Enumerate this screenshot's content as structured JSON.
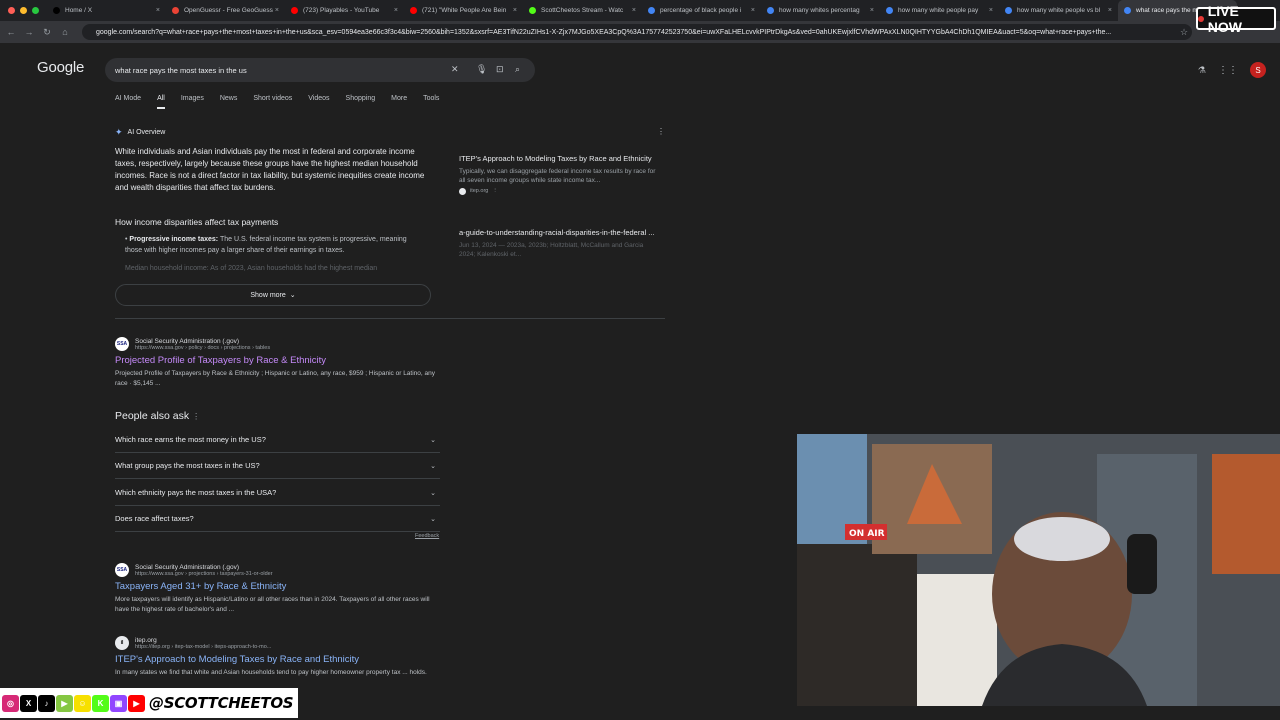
{
  "browser": {
    "tabs": [
      {
        "label": "Home / X",
        "color": "#000000"
      },
      {
        "label": "OpenGuessr - Free GeoGuess",
        "color": "#ea4335"
      },
      {
        "label": "(723) Playables - YouTube",
        "color": "#ff0000"
      },
      {
        "label": "(721) \"White People Are Bein",
        "color": "#ff0000"
      },
      {
        "label": "ScottCheetos Stream - Watc",
        "color": "#53fc18"
      },
      {
        "label": "percentage of black people i",
        "color": "#4285f4"
      },
      {
        "label": "how many whites percentag",
        "color": "#4285f4"
      },
      {
        "label": "how many white people pay",
        "color": "#4285f4"
      },
      {
        "label": "how many white people vs bl",
        "color": "#4285f4"
      },
      {
        "label": "what race pays the most",
        "color": "#4285f4"
      }
    ],
    "url": "google.com/search?q=what+race+pays+the+most+taxes+in+the+us&sca_esv=0594ea3e66c3f3c4&biw=2560&bih=1352&sxsrf=AE3TifN22uZIHs1-X-Zjx7MJGo5XEA3CpQ%3A1757742523750&ei=uwXFaLHELcvvkPIPtrDkgAs&ved=0ahUKEwjxlfCVhdWPAxXLN0QIHTYYGbA4ChDh1QMIEA&uact=5&oq=what+race+pays+the..."
  },
  "google": {
    "logo": "Google",
    "query": "what race pays the most taxes in the us",
    "nav_tabs": [
      "AI Mode",
      "All",
      "Images",
      "News",
      "Short videos",
      "Videos",
      "Shopping",
      "More",
      "Tools"
    ],
    "profile_initial": "S"
  },
  "ai_overview": {
    "label": "AI Overview",
    "text": "White individuals and Asian individuals pay the most in federal and corporate income taxes, respectively, largely because these groups have the highest median household incomes. Race is not a direct factor in tax liability, but systemic inequities create income and wealth disparities that affect tax burdens.",
    "subheading": "How income disparities affect tax payments",
    "bullet_bold": "Progressive income taxes:",
    "bullet_text": " The U.S. federal income tax system is progressive, meaning those with higher incomes pay a larger share of their earnings in taxes.",
    "faded_text": "Median household income: As of 2023, Asian households had the highest median",
    "show_more": "Show more",
    "sources": [
      {
        "title": "ITEP's Approach to Modeling Taxes by Race and Ethnicity",
        "desc": "Typically, we can disaggregate federal income tax results by race for all seven income groups while state income tax...",
        "site": "itep.org"
      },
      {
        "title": "a-guide-to-understanding-racial-disparities-in-the-federal ...",
        "desc": "Jun 13, 2024 — 2023a, 2023b; Holtzblatt, McCallum and Garcia 2024; Kalenkoski et...",
        "site": ""
      }
    ]
  },
  "results": [
    {
      "site": "Social Security Administration (.gov)",
      "url": "https://www.ssa.gov › policy › docs › projections › tables",
      "title": "Projected Profile of Taxpayers by Race & Ethnicity",
      "snippet": "Projected Profile of Taxpayers by Race & Ethnicity ; Hispanic or Latino, any race, $959 ; Hispanic or Latino, any race · $5,145 ...",
      "favicon": "SSA"
    },
    {
      "site": "Social Security Administration (.gov)",
      "url": "https://www.ssa.gov › projections › taxpayers-31-or-older",
      "title": "Taxpayers Aged 31+ by Race & Ethnicity",
      "snippet": "More taxpayers will identify as Hispanic/Latino or all other races than in 2024. Taxpayers of all other races will have the highest rate of bachelor's and ...",
      "favicon": "SSA"
    },
    {
      "site": "itep.org",
      "url": "https://itep.org › itep-tax-model › iteps-approach-to-mo...",
      "title": "ITEP's Approach to Modeling Taxes by Race and Ethnicity",
      "snippet": "In many states we find that white and Asian households tend to pay higher homeowner property tax ... holds.",
      "favicon": "il"
    }
  ],
  "people_also_ask": {
    "title": "People also ask",
    "questions": [
      "Which race earns the most money in the US?",
      "What group pays the most taxes in the US?",
      "Which ethnicity pays the most taxes in the USA?",
      "Does race affect taxes?"
    ],
    "feedback": "Feedback"
  },
  "overlay": {
    "live_label": "LIVE NOW",
    "handle": "@SCOTTCHEETOS",
    "social_icons": [
      {
        "name": "instagram-icon",
        "glyph": "◎",
        "color": "#d62976"
      },
      {
        "name": "x-icon",
        "glyph": "X",
        "color": "#000000"
      },
      {
        "name": "tiktok-icon",
        "glyph": "♪",
        "color": "#000000"
      },
      {
        "name": "rumble-icon",
        "glyph": "▶",
        "color": "#85c742"
      },
      {
        "name": "snapchat-icon",
        "glyph": "☺",
        "color": "#f7e000"
      },
      {
        "name": "kick-icon",
        "glyph": "K",
        "color": "#53fc18"
      },
      {
        "name": "twitch-icon",
        "glyph": "▣",
        "color": "#9146ff"
      },
      {
        "name": "youtube-icon",
        "glyph": "▶",
        "color": "#ff0000"
      }
    ],
    "webcam_sign": "ON AIR"
  }
}
